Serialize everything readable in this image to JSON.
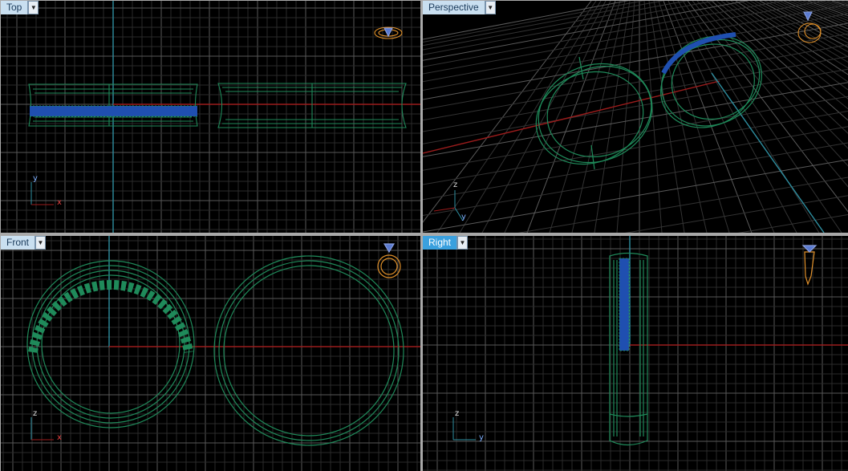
{
  "viewports": {
    "top": {
      "label": "Top",
      "axis_a": "y",
      "axis_b": "x"
    },
    "perspective": {
      "label": "Perspective",
      "axis_a": "z",
      "axis_b": "y"
    },
    "front": {
      "label": "Front",
      "axis_a": "z",
      "axis_b": "x"
    },
    "right": {
      "label": "Right",
      "axis_a": "z",
      "axis_b": "y"
    }
  },
  "active_viewport": "right",
  "colors": {
    "grid_minor": "#2a2a2a",
    "grid_major": "#585858",
    "axis_x": "#9b1c1c",
    "axis_y": "#2e8ea0",
    "ring": "#1f8a5a",
    "stones": "#1f4fb0",
    "nav_icon": "#e0902a"
  },
  "icons": [
    "ring-navigation-icon",
    "dropdown-arrow-icon"
  ]
}
